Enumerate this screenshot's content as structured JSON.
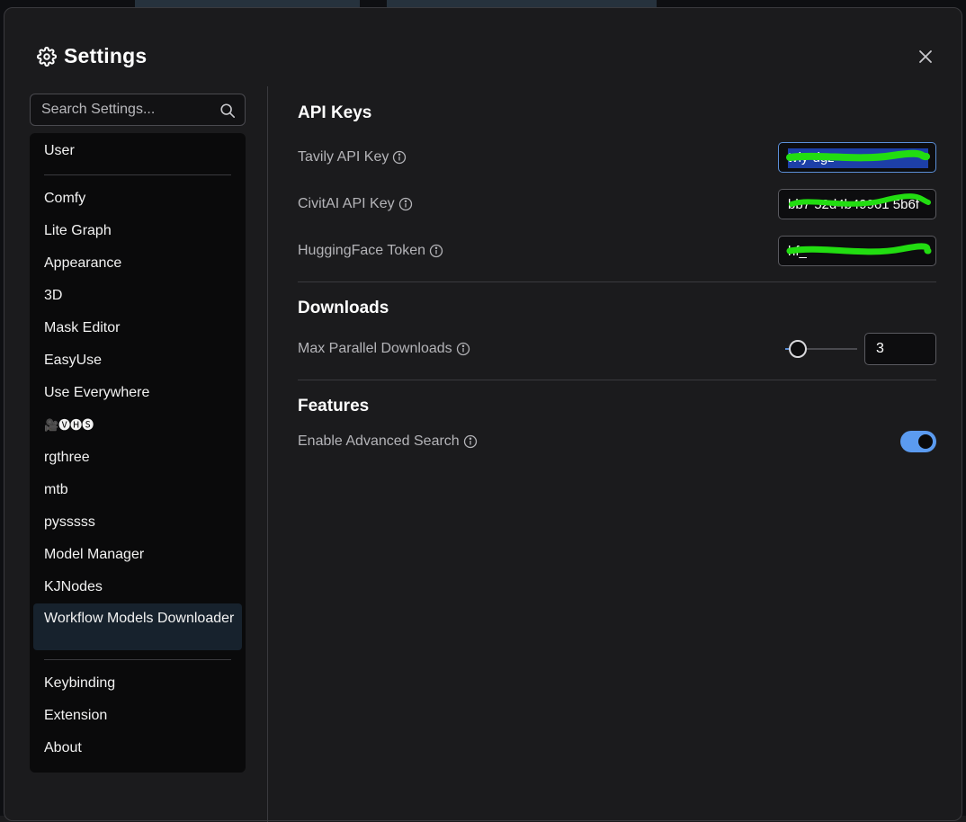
{
  "dialog": {
    "title": "Settings",
    "title_icon": "gear-icon",
    "close_icon": "close-icon"
  },
  "search": {
    "placeholder": "Search Settings...",
    "icon": "search-icon"
  },
  "sidebar": {
    "items": [
      {
        "label": "User",
        "group": 0
      },
      {
        "label": "Comfy",
        "group": 1
      },
      {
        "label": "Lite Graph",
        "group": 1
      },
      {
        "label": "Appearance",
        "group": 1
      },
      {
        "label": "3D",
        "group": 1
      },
      {
        "label": "Mask Editor",
        "group": 1
      },
      {
        "label": "EasyUse",
        "group": 1
      },
      {
        "label": "Use Everywhere",
        "group": 1
      },
      {
        "label": "🎥🅥🅗🅢",
        "group": 1
      },
      {
        "label": "rgthree",
        "group": 1
      },
      {
        "label": "mtb",
        "group": 1
      },
      {
        "label": "pysssss",
        "group": 1
      },
      {
        "label": "Model Manager",
        "group": 1
      },
      {
        "label": "KJNodes",
        "group": 1
      },
      {
        "label": "Workflow Models Downloader",
        "group": 1,
        "active": true
      },
      {
        "label": "Keybinding",
        "group": 2
      },
      {
        "label": "Extension",
        "group": 2
      },
      {
        "label": "About",
        "group": 2
      }
    ]
  },
  "sections": {
    "api_keys": {
      "title": "API Keys",
      "tavily": {
        "label": "Tavily API Key",
        "value": "tvly-dgz"
      },
      "civitai": {
        "label": "CivitAI API Key",
        "value": "bb7 52d4b49961 5b6f"
      },
      "huggingface": {
        "label": "HuggingFace Token",
        "value": "hf_"
      }
    },
    "downloads": {
      "title": "Downloads",
      "max_parallel": {
        "label": "Max Parallel Downloads",
        "value": "3",
        "slider_fraction": 0.06
      }
    },
    "features": {
      "title": "Features",
      "advanced_search": {
        "label": "Enable Advanced Search",
        "enabled": true
      }
    }
  },
  "colors": {
    "accent": "#5b9bf0",
    "redaction": "#22dd11"
  }
}
